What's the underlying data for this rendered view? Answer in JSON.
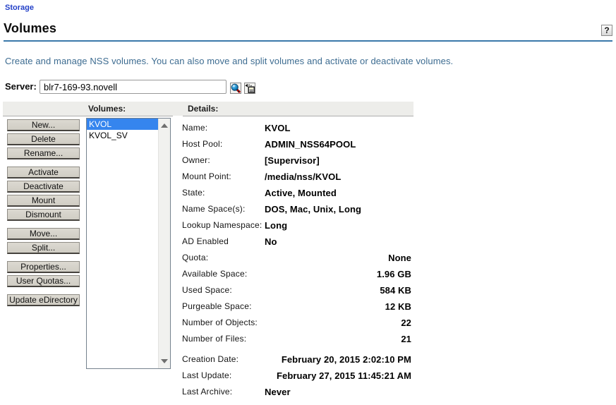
{
  "page": {
    "breadcrumb": "Storage",
    "title": "Volumes",
    "help_label": "?",
    "description": "Create and manage NSS volumes. You can also move and split volumes and activate or deactivate volumes."
  },
  "server": {
    "label": "Server:",
    "value": "blr7-169-93.novell"
  },
  "panel": {
    "volumes_header": "Volumes:",
    "details_header": "Details:"
  },
  "actions": {
    "groups": [
      [
        "New...",
        "Delete",
        "Rename..."
      ],
      [
        "Activate",
        "Deactivate",
        "Mount",
        "Dismount"
      ],
      [
        "Move...",
        "Split..."
      ],
      [
        "Properties...",
        "User Quotas..."
      ],
      [
        "Update eDirectory"
      ]
    ]
  },
  "volumes": {
    "items": [
      {
        "name": "KVOL",
        "selected": true
      },
      {
        "name": "KVOL_SV",
        "selected": false
      }
    ]
  },
  "details": {
    "sections": [
      {
        "id": "identity",
        "rows": [
          {
            "label": "Name:",
            "value": "KVOL",
            "align": "left"
          },
          {
            "label": "Host Pool:",
            "value": "ADMIN_NSS64POOL",
            "align": "left"
          },
          {
            "label": "Owner:",
            "value": "[Supervisor]",
            "align": "left"
          },
          {
            "label": "Mount Point:",
            "value": "/media/nss/KVOL",
            "align": "left"
          },
          {
            "label": "State:",
            "value": "Active, Mounted",
            "align": "left"
          },
          {
            "label": "Name Space(s):",
            "value": "DOS, Mac, Unix, Long",
            "align": "left"
          },
          {
            "label": "Lookup Namespace:",
            "value": "Long",
            "align": "left"
          },
          {
            "label": "AD Enabled",
            "value": "No",
            "align": "left"
          }
        ]
      },
      {
        "id": "space",
        "rows": [
          {
            "label": "Quota:",
            "value": "None",
            "align": "right"
          },
          {
            "label": "Available Space:",
            "value": "1.96 GB",
            "align": "right"
          },
          {
            "label": "Used Space:",
            "value": "584 KB",
            "align": "right"
          },
          {
            "label": "Purgeable Space:",
            "value": "12 KB",
            "align": "right"
          },
          {
            "label": "Number of Objects:",
            "value": "22",
            "align": "right"
          },
          {
            "label": "Number of Files:",
            "value": "21",
            "align": "right"
          }
        ]
      },
      {
        "id": "dates",
        "rows": [
          {
            "label": "Creation Date:",
            "value": "February 20, 2015 2:02:10 PM",
            "align": "right"
          },
          {
            "label": "Last Update:",
            "value": "February 27, 2015 11:45:21 AM",
            "align": "right"
          },
          {
            "label": "Last Archive:",
            "value": "Never",
            "align": "left"
          }
        ]
      }
    ]
  },
  "colors": {
    "link": "#2340c8",
    "rule": "#3a79aa",
    "desc": "#3d6c91",
    "band": "#ededea",
    "sel": "#3585ee"
  }
}
